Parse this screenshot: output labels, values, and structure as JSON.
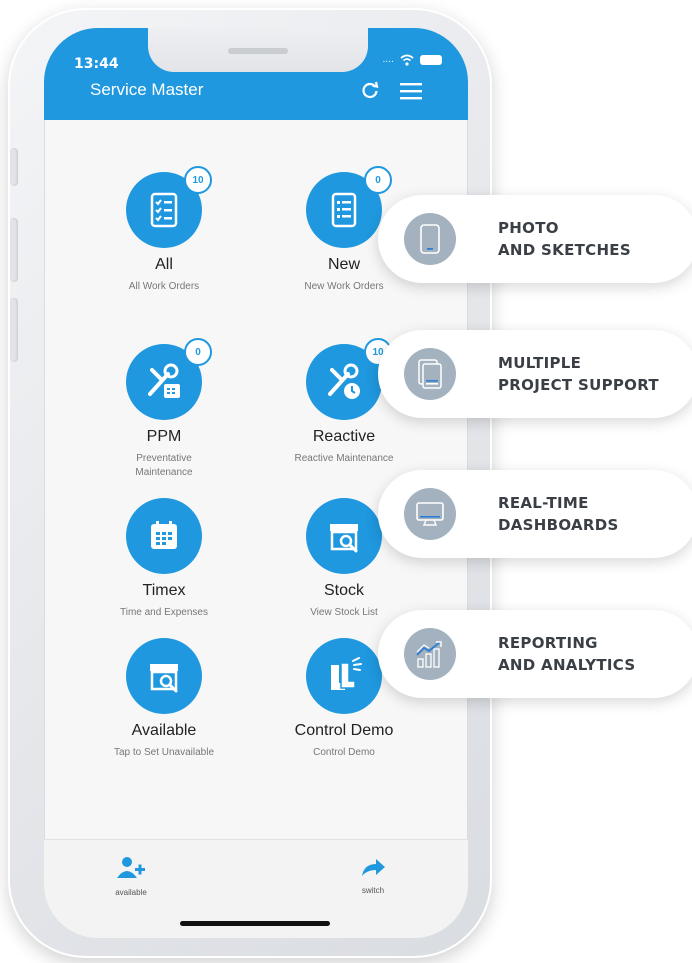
{
  "status_bar": {
    "time": "13:44",
    "signal": "...."
  },
  "header": {
    "title": "Service Master"
  },
  "tiles": [
    {
      "title": "All",
      "subtitle": "All Work Orders",
      "badge": "10"
    },
    {
      "title": "New",
      "subtitle": "New Work Orders",
      "badge": "0"
    },
    {
      "title": "PPM",
      "subtitle": "Preventative\nMaintenance",
      "badge": "0"
    },
    {
      "title": "Reactive",
      "subtitle": "Reactive Maintenance",
      "badge": "10"
    },
    {
      "title": "Timex",
      "subtitle": "Time and Expenses"
    },
    {
      "title": "Stock",
      "subtitle": "View Stock List"
    },
    {
      "title": "Available",
      "subtitle": "Tap to Set Unavailable"
    },
    {
      "title": "Control Demo",
      "subtitle": "Control Demo"
    }
  ],
  "tabbar": {
    "left_label": "available",
    "right_label": "switch"
  },
  "features": [
    {
      "text": "PHOTO\nAND SKETCHES",
      "icon": "smartphone-icon"
    },
    {
      "text": "MULTIPLE\nPROJECT SUPPORT",
      "icon": "documents-icon"
    },
    {
      "text": "REAL-TIME\nDASHBOARDS",
      "icon": "monitor-icon"
    },
    {
      "text": "REPORTING\nAND ANALYTICS",
      "icon": "analytics-chart-icon"
    }
  ],
  "colors": {
    "accent": "#1f98df",
    "feature_icon_bg": "#a4b2bf",
    "feature_text": "#3a3f45"
  }
}
